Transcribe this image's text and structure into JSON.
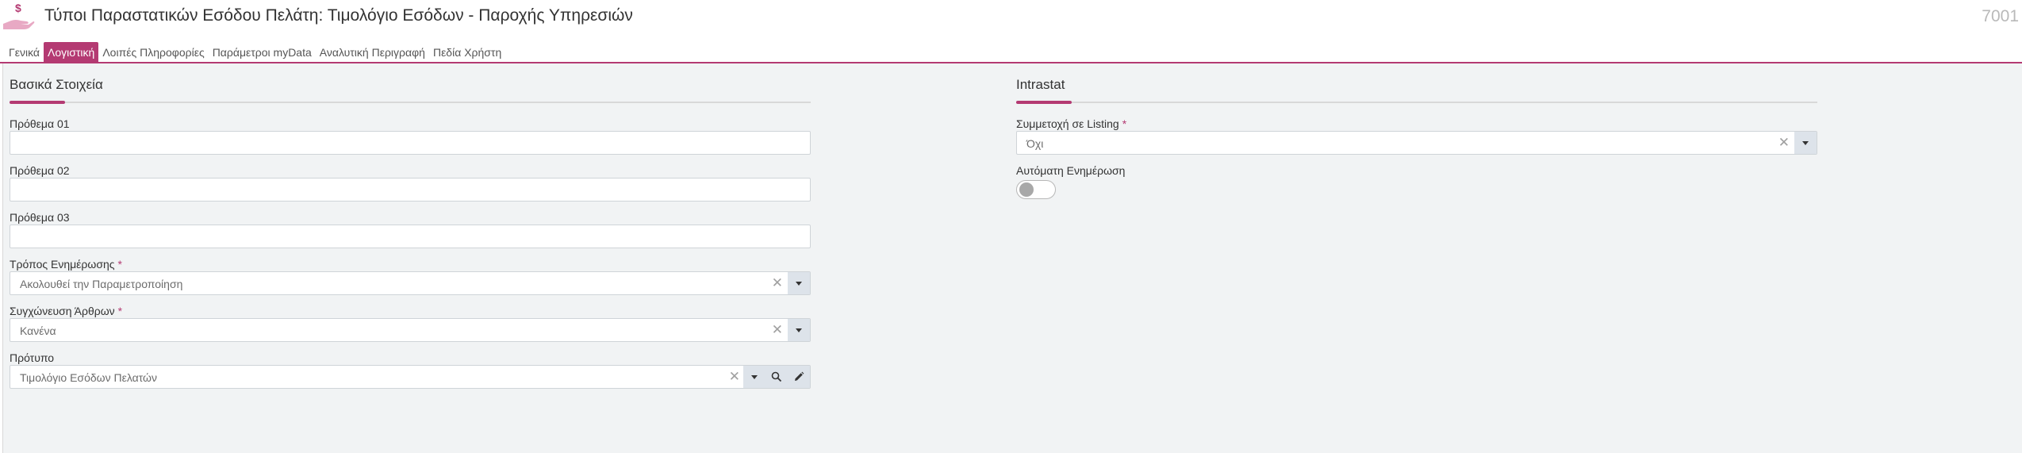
{
  "header": {
    "icon": "hand-money-icon",
    "title": "Τύποι Παραστατικών Εσόδου Πελάτη: Τιμολόγιο Εσόδων - Παροχής Υπηρεσιών",
    "record_id": "7001"
  },
  "tabs": [
    {
      "label": "Γενικά",
      "active": false
    },
    {
      "label": "Λογιστική",
      "active": true
    },
    {
      "label": "Λοιπές Πληροφορίες",
      "active": false
    },
    {
      "label": "Παράμετροι myData",
      "active": false
    },
    {
      "label": "Αναλυτική Περιγραφή",
      "active": false
    },
    {
      "label": "Πεδία Χρήστη",
      "active": false
    }
  ],
  "basic": {
    "title": "Βασικά Στοιχεία",
    "prefix1": {
      "label": "Πρόθεμα 01",
      "value": ""
    },
    "prefix2": {
      "label": "Πρόθεμα 02",
      "value": ""
    },
    "prefix3": {
      "label": "Πρόθεμα 03",
      "value": ""
    },
    "update_mode": {
      "label": "Τρόπος Ενημέρωσης",
      "value": "Ακολουθεί την Παραμετροποίηση",
      "required": "*"
    },
    "merge_items": {
      "label": "Συγχώνευση Άρθρων",
      "value": "Κανένα",
      "required": "*"
    },
    "template": {
      "label": "Πρότυπο",
      "value": "Τιμολόγιο Εσόδων Πελατών"
    }
  },
  "intrastat": {
    "title": "Intrastat",
    "listing": {
      "label": "Συμμετοχή σε Listing",
      "value": "Όχι",
      "required": "*"
    },
    "auto_update": {
      "label": "Αυτόματη Ενημέρωση",
      "on": false
    }
  },
  "icons": {
    "clear": "✕",
    "search": "search-icon",
    "edit": "pencil-icon",
    "dropdown": "caret-down-icon"
  },
  "colors": {
    "accent": "#b43a72",
    "background": "#f1f3f4"
  }
}
